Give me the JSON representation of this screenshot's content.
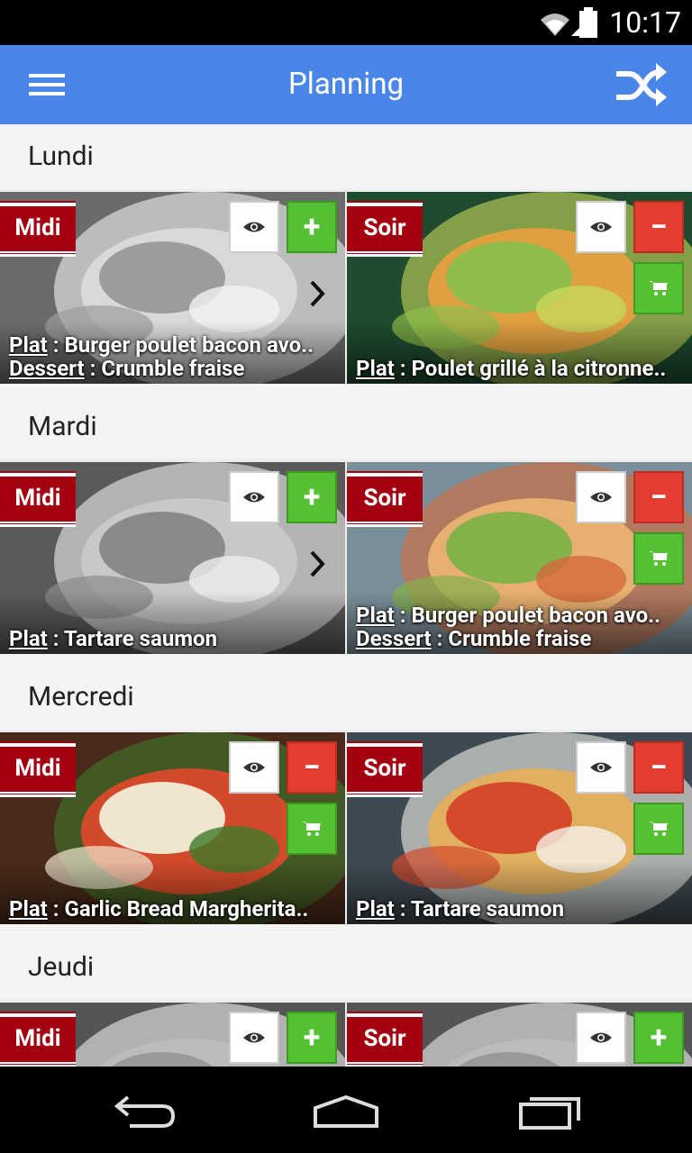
{
  "status_bar": {
    "time": "10:17"
  },
  "app_bar": {
    "title": "Planning",
    "menu_icon": "menu-icon",
    "shuffle_icon": "shuffle-icon"
  },
  "colors": {
    "app_bar": "#4A86E8",
    "badge": "#A30010",
    "add": "#54C132",
    "remove": "#E53D32"
  },
  "days": [
    {
      "name": "Lundi",
      "midi": {
        "label": "Midi",
        "action": "+",
        "has_cart": false,
        "has_chevron": true,
        "lines": [
          {
            "kind": "Plat",
            "text": " : Burger poulet bacon avo.."
          },
          {
            "kind": "Dessert",
            "text": " : Crumble fraise"
          }
        ]
      },
      "soir": {
        "label": "Soir",
        "action": "−",
        "has_cart": true,
        "has_chevron": false,
        "lines": [
          {
            "kind": "Plat",
            "text": " : Poulet grillé à la citronne.."
          }
        ]
      }
    },
    {
      "name": "Mardi",
      "midi": {
        "label": "Midi",
        "action": "+",
        "has_cart": false,
        "has_chevron": true,
        "lines": [
          {
            "kind": "Plat",
            "text": " : Tartare saumon"
          }
        ]
      },
      "soir": {
        "label": "Soir",
        "action": "−",
        "has_cart": true,
        "has_chevron": false,
        "lines": [
          {
            "kind": "Plat",
            "text": " : Burger poulet bacon avo.."
          },
          {
            "kind": "Dessert",
            "text": " : Crumble fraise"
          }
        ]
      }
    },
    {
      "name": "Mercredi",
      "midi": {
        "label": "Midi",
        "action": "−",
        "has_cart": true,
        "has_chevron": false,
        "lines": [
          {
            "kind": "Plat",
            "text": " : Garlic Bread Margherita.."
          }
        ]
      },
      "soir": {
        "label": "Soir",
        "action": "−",
        "has_cart": true,
        "has_chevron": false,
        "lines": [
          {
            "kind": "Plat",
            "text": " : Tartare saumon"
          }
        ]
      }
    },
    {
      "name": "Jeudi",
      "midi": {
        "label": "Midi",
        "action": "+",
        "has_cart": false,
        "has_chevron": false,
        "lines": []
      },
      "soir": {
        "label": "Soir",
        "action": "+",
        "has_cart": false,
        "has_chevron": false,
        "lines": []
      }
    }
  ]
}
